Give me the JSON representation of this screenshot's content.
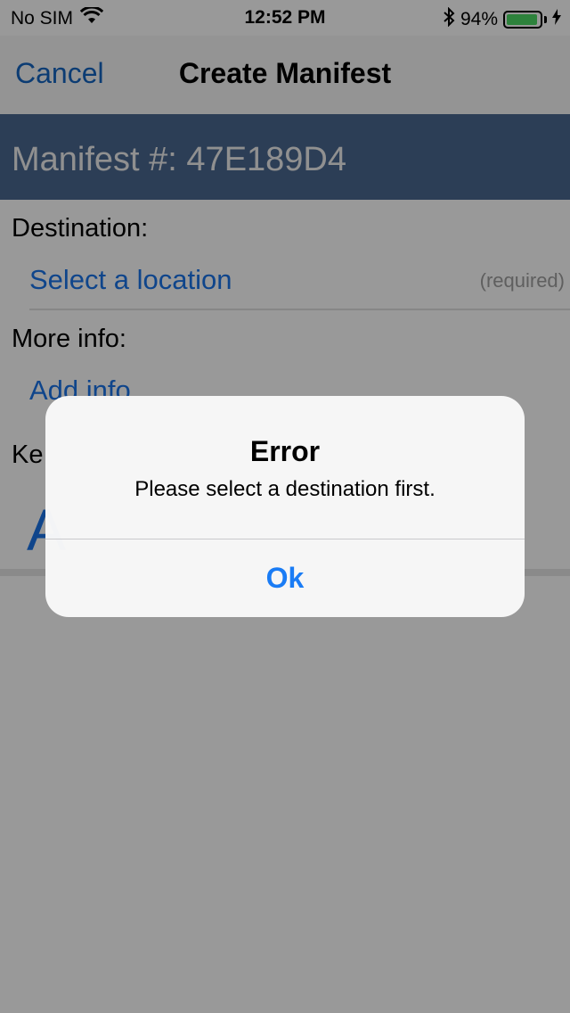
{
  "status_bar": {
    "carrier": "No SIM",
    "time": "12:52 PM",
    "battery_percent": "94%",
    "battery_level": 0.94,
    "icons": [
      "wifi-icon",
      "bluetooth-icon",
      "battery-icon",
      "charging-bolt-icon"
    ]
  },
  "nav": {
    "cancel_label": "Cancel",
    "title": "Create Manifest"
  },
  "manifest": {
    "header_text": "Manifest #: 47E189D4"
  },
  "form": {
    "destination_label": "Destination:",
    "destination_link": "Select a location",
    "destination_hint": "(required)",
    "more_info_label": "More info:",
    "more_info_link": "Add info",
    "third_label_partial": "Ke",
    "big_letter": "A"
  },
  "alert": {
    "title": "Error",
    "message": "Please select a destination first.",
    "button_label": "Ok"
  },
  "colors": {
    "accent_blue": "#1a73e8",
    "header_navy": "#4a6890",
    "alert_button_blue": "#1a7cf5",
    "battery_green": "#4cd964"
  }
}
